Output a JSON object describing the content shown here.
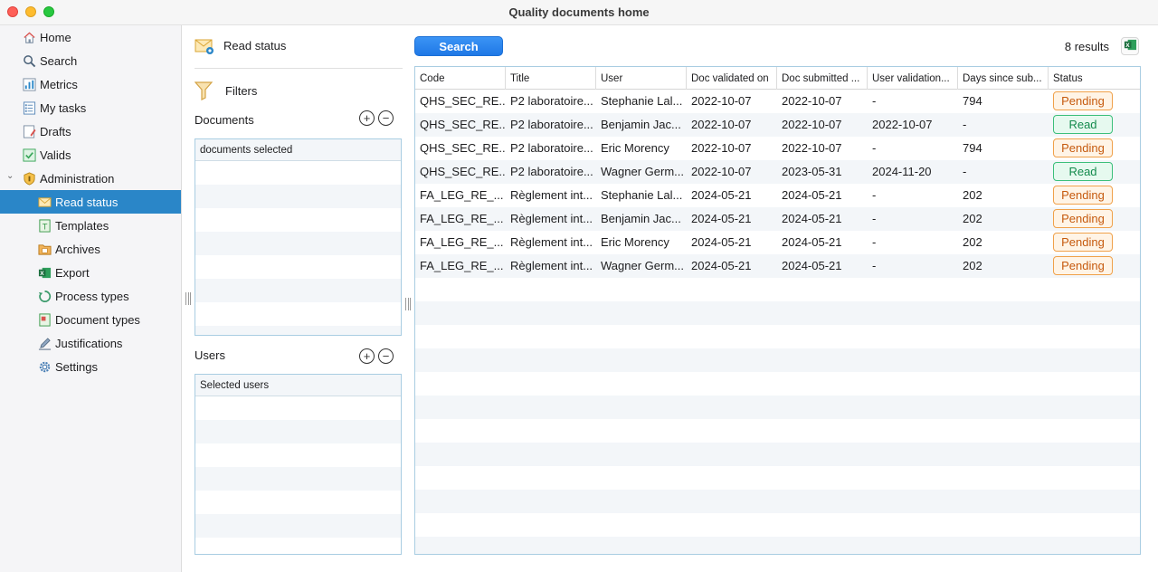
{
  "window": {
    "title": "Quality documents home"
  },
  "sidebar": {
    "items": [
      {
        "label": "Home",
        "icon": "home-icon"
      },
      {
        "label": "Search",
        "icon": "search-icon"
      },
      {
        "label": "Metrics",
        "icon": "metrics-icon"
      },
      {
        "label": "My tasks",
        "icon": "tasks-icon"
      },
      {
        "label": "Drafts",
        "icon": "drafts-icon"
      },
      {
        "label": "Valids",
        "icon": "valids-icon"
      },
      {
        "label": "Administration",
        "icon": "shield-icon",
        "expanded": true
      },
      {
        "label": "Read status",
        "icon": "envelope-icon",
        "selected": true
      },
      {
        "label": "Templates",
        "icon": "template-icon"
      },
      {
        "label": "Archives",
        "icon": "archive-icon"
      },
      {
        "label": "Export",
        "icon": "excel-icon"
      },
      {
        "label": "Process types",
        "icon": "process-icon"
      },
      {
        "label": "Document types",
        "icon": "document-type-icon"
      },
      {
        "label": "Justifications",
        "icon": "pen-icon"
      },
      {
        "label": "Settings",
        "icon": "gear-icon"
      }
    ]
  },
  "panel": {
    "title": "Read status",
    "filters_label": "Filters",
    "documents": {
      "label": "Documents",
      "header": "documents selected"
    },
    "users": {
      "label": "Users",
      "header": "Selected users"
    }
  },
  "toolbar": {
    "search_label": "Search",
    "results": "8 results",
    "export_icon": "excel-icon"
  },
  "table": {
    "columns": [
      "Code",
      "Title",
      "User",
      "Doc validated on",
      "Doc submitted ...",
      "User validation...",
      "Days since sub...",
      "Status"
    ],
    "rows": [
      [
        "QHS_SEC_RE...",
        "P2 laboratoire...",
        "Stephanie Lal...",
        "2022-10-07",
        "2022-10-07",
        "-",
        "794",
        "Pending"
      ],
      [
        "QHS_SEC_RE...",
        "P2 laboratoire...",
        "Benjamin Jac...",
        "2022-10-07",
        "2022-10-07",
        "2022-10-07",
        "-",
        "Read"
      ],
      [
        "QHS_SEC_RE...",
        "P2 laboratoire...",
        "Eric Morency",
        "2022-10-07",
        "2022-10-07",
        "-",
        "794",
        "Pending"
      ],
      [
        "QHS_SEC_RE...",
        "P2 laboratoire...",
        "Wagner Germ...",
        "2022-10-07",
        "2023-05-31",
        "2024-11-20",
        "-",
        "Read"
      ],
      [
        "FA_LEG_RE_...",
        "Règlement int...",
        "Stephanie Lal...",
        "2024-05-21",
        "2024-05-21",
        "-",
        "202",
        "Pending"
      ],
      [
        "FA_LEG_RE_...",
        "Règlement int...",
        "Benjamin Jac...",
        "2024-05-21",
        "2024-05-21",
        "-",
        "202",
        "Pending"
      ],
      [
        "FA_LEG_RE_...",
        "Règlement int...",
        "Eric Morency",
        "2024-05-21",
        "2024-05-21",
        "-",
        "202",
        "Pending"
      ],
      [
        "FA_LEG_RE_...",
        "Règlement int...",
        "Wagner Germ...",
        "2024-05-21",
        "2024-05-21",
        "-",
        "202",
        "Pending"
      ]
    ]
  },
  "colors": {
    "accent": "#2a86c8",
    "pending": "#c65a0e",
    "read": "#138a4c"
  }
}
